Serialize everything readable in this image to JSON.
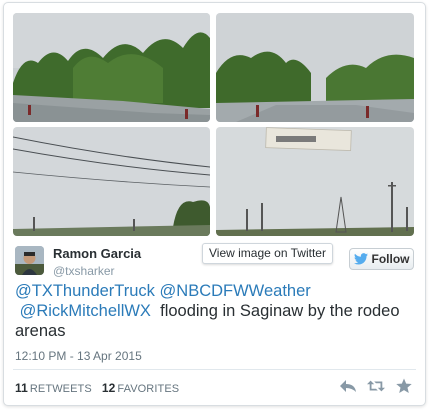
{
  "author": {
    "display_name": "Ramon Garcia",
    "screen_name": "@txsharker"
  },
  "view_image_tooltip": "View image on Twitter",
  "follow": {
    "label": "Follow",
    "icon": "twitter-bird-icon"
  },
  "tweet": {
    "mention_1": "@TXThunderTruck",
    "mention_2": "@NBCDFWWeather",
    "mention_3": "@RickMitchellWX",
    "text": "flooding in Saginaw by the rodeo arenas"
  },
  "timestamp": "12:10 PM - 13 Apr 2015",
  "stats": {
    "retweets_count": "11",
    "retweets_label": "RETWEETS",
    "favorites_count": "12",
    "favorites_label": "FAVORITES"
  },
  "actions": [
    "reply-icon",
    "retweet-icon",
    "favorite-icon"
  ],
  "colors": {
    "mention": "#2b7bb9",
    "muted": "#8899a6",
    "text": "#292f33"
  }
}
